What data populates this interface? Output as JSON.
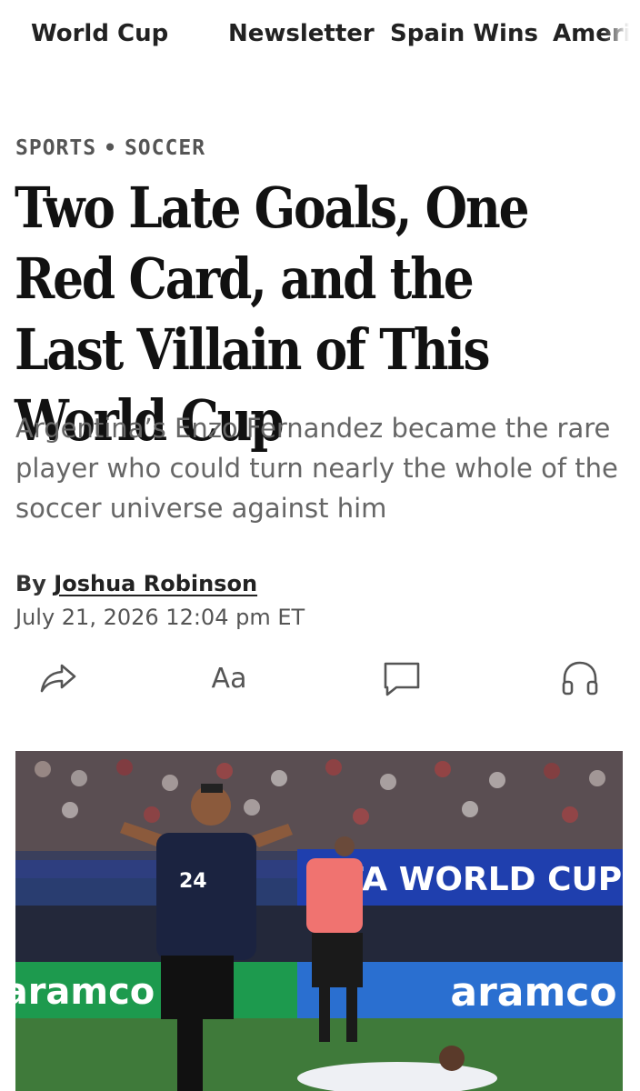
{
  "nav": {
    "items": [
      "World Cup",
      "Newsletter",
      "Spain Wins",
      "Ameri"
    ]
  },
  "article": {
    "kicker_section": "SPORTS",
    "kicker_separator": "•",
    "kicker_subsection": "SOCCER",
    "headline": "Two Late Goals, One Red Card, and the Last Villain of This World Cup",
    "dek": "Argentina’s Enzo Fernandez became the rare player who could turn nearly the whole of the soccer universe against him",
    "byline_prefix": "By",
    "author": "Joshua Robinson",
    "timestamp": "July 21, 2026 12:04 pm ET"
  },
  "toolbar": {
    "share_icon": "share-icon",
    "text_size_label": "Aa",
    "comments_icon": "comment-icon",
    "listen_icon": "headphones-icon"
  },
  "photo": {
    "banner_text": "FIFA WORLD CUP",
    "board_left": "aramco",
    "board_right": "aramco",
    "jersey_number": "24"
  },
  "colors": {
    "text": "#111111",
    "muted": "#666666",
    "pitch": "#3f7a3a",
    "banner": "#1f3fae",
    "board_green": "#1d9a4e",
    "board_blue": "#2a6fd0"
  }
}
